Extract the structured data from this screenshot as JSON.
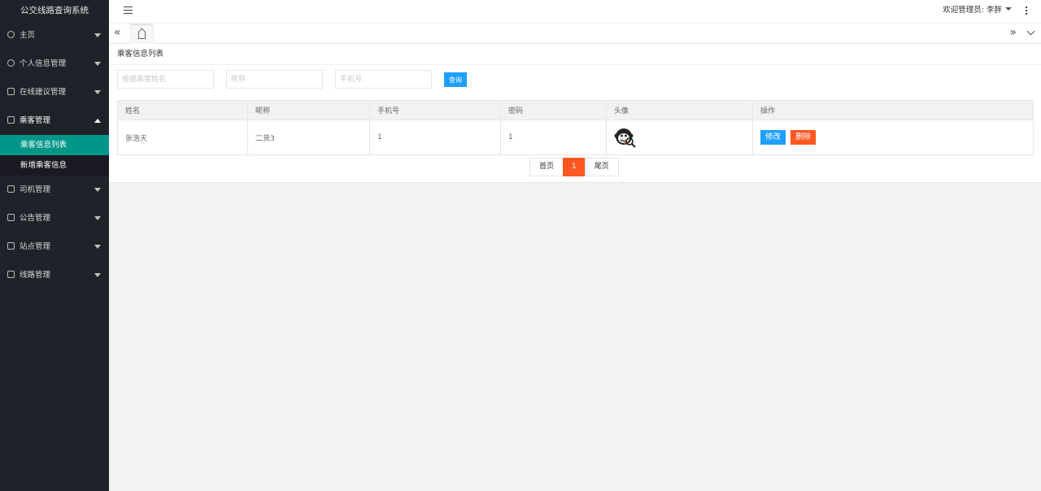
{
  "app": {
    "title": "公交线路查询系统"
  },
  "sidebar": {
    "items": [
      {
        "label": "主页"
      },
      {
        "label": "个人信息管理"
      },
      {
        "label": "在线建议管理"
      },
      {
        "label": "乘客管理",
        "expanded": true,
        "children": [
          {
            "label": "乘客信息列表",
            "selected": true
          },
          {
            "label": "新增乘客信息"
          }
        ]
      },
      {
        "label": "司机管理"
      },
      {
        "label": "公告管理"
      },
      {
        "label": "站点管理"
      },
      {
        "label": "线路管理"
      }
    ]
  },
  "header": {
    "welcome": "欢迎管理员: 李胖"
  },
  "page": {
    "title": "乘客信息列表"
  },
  "search": {
    "name_placeholder": "根据乘客姓名",
    "nickname_placeholder": "昵称",
    "phone_placeholder": "手机号",
    "button": "查询"
  },
  "table": {
    "headers": [
      "姓名",
      "昵称",
      "手机号",
      "密码",
      "头像",
      "操作"
    ],
    "rows": [
      {
        "name": "张浩天",
        "nickname": "二货3",
        "phone": "1",
        "password": "1",
        "avatar_icon": "monkey-avatar"
      }
    ],
    "edit_label": "修改",
    "delete_label": "删除"
  },
  "pagination": {
    "first": "首页",
    "current": "1",
    "last": "尾页"
  },
  "colors": {
    "sidebar_bg": "#20222a",
    "selected": "#009688",
    "primary": "#1e9fff",
    "danger": "#ff5722"
  }
}
